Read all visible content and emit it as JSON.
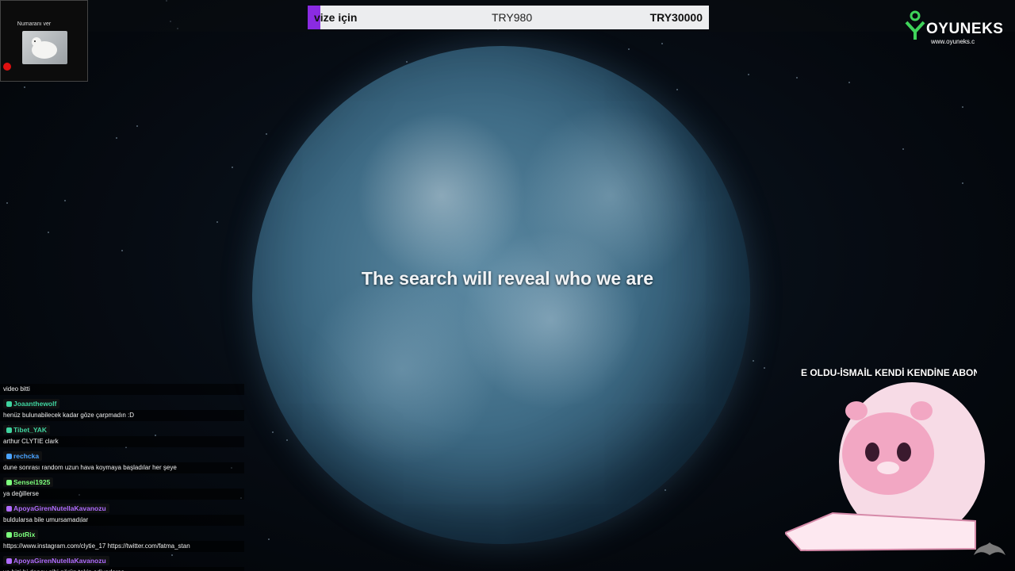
{
  "colors": {
    "accent": "#8a2be2",
    "logo_green": "#3fd45a",
    "mascot_pink": "#f2a7c3"
  },
  "donation_bar": {
    "label": "vize için",
    "current": "TRY980",
    "goal": "TRY30000"
  },
  "webcam": {
    "label": "Numaranı ver"
  },
  "logo": {
    "brand": "OYUNEKS",
    "site": "www.oyuneks.c"
  },
  "subtitle": "The search will reveal who we are",
  "ticker": "E OLDU-İSMAİL KENDİ KENDİNE ABONE",
  "chat": {
    "partial_line": "video bitti",
    "messages": [
      {
        "user": "Joaanthewolf",
        "color": "#3fd4a0",
        "text": "henüz bulunabilecek kadar göze çarpmadın :D"
      },
      {
        "user": "Tibet_YAK",
        "color": "#3fd4a0",
        "text": "arthur CLYTIE clark"
      },
      {
        "user": "rechcka",
        "color": "#4aa3ff",
        "text": "dune sonrası random uzun hava koymaya başladılar her şeye"
      },
      {
        "user": "Sensei1925",
        "color": "#7dff7d",
        "text": "ya değillerse"
      },
      {
        "user": "ApoyaGirenNutellaKavanozu",
        "color": "#b06cff",
        "text": "buldularsa bile umursamadılar"
      },
      {
        "user": "BotRix",
        "color": "#7dff7d",
        "text": "https://www.instagram.com/clytie_17 https://twitter.com/fatma_stan"
      },
      {
        "user": "ApoyaGirenNutellaKavanozu",
        "color": "#b06cff",
        "text": "ya bizi bi deney gibi görüp takip ediyorlarsa"
      }
    ]
  }
}
